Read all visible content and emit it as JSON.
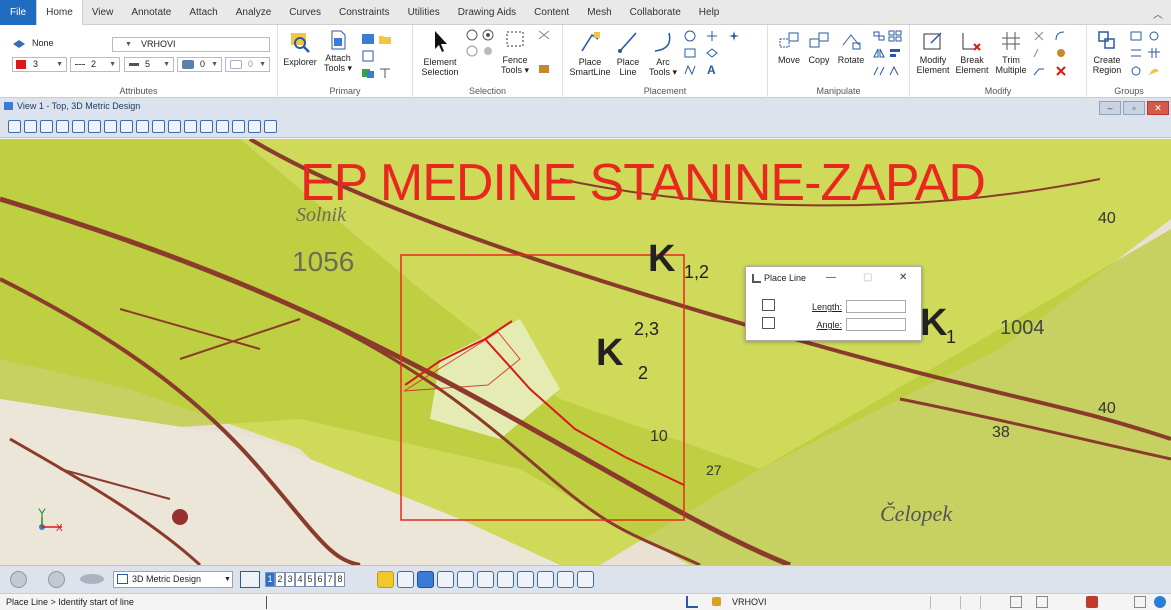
{
  "menu": {
    "tabs": [
      "File",
      "Home",
      "View",
      "Annotate",
      "Attach",
      "Analyze",
      "Curves",
      "Constraints",
      "Utilities",
      "Drawing Aids",
      "Content",
      "Mesh",
      "Collaborate",
      "Help"
    ],
    "active": "Home"
  },
  "ribbon": {
    "attributes": {
      "level": "None",
      "level2": "VRHOVI",
      "color_value": "3",
      "style_value": "2",
      "weight_value": "5",
      "transparency_value": "0",
      "priority_value": "0",
      "title": "Attributes"
    },
    "primary": {
      "explorer": "Explorer",
      "attach_tools_1": "Attach",
      "attach_tools_2": "Tools ▾",
      "title": "Primary"
    },
    "selection": {
      "element_selection_1": "Element",
      "element_selection_2": "Selection",
      "fence_tools_1": "Fence",
      "fence_tools_2": "Tools ▾",
      "title": "Selection"
    },
    "placement": {
      "place_smartline_1": "Place",
      "place_smartline_2": "SmartLine",
      "place_line_1": "Place",
      "place_line_2": "Line",
      "arc_tools_1": "Arc",
      "arc_tools_2": "Tools ▾",
      "title": "Placement"
    },
    "manipulate": {
      "move": "Move",
      "copy": "Copy",
      "rotate": "Rotate",
      "title": "Manipulate"
    },
    "modify": {
      "modify_element_1": "Modify",
      "modify_element_2": "Element",
      "break_element_1": "Break",
      "break_element_2": "Element",
      "trim_multiple_1": "Trim",
      "trim_multiple_2": "Multiple",
      "title": "Modify"
    },
    "groups": {
      "create_region_1": "Create",
      "create_region_2": "Region",
      "title": "Groups"
    }
  },
  "view": {
    "title": "View 1 - Top, 3D Metric Design"
  },
  "map": {
    "title": "EP MEDINE STANINE-ZAPAD",
    "labels": {
      "k12": "K",
      "k12_sub": "1,2",
      "k223": "K",
      "k223_sup": "2,3",
      "k223_sub": "2",
      "k1": "K",
      "k1_sub": "1",
      "n1056": "1056",
      "n1004": "1004",
      "n40a": "40",
      "n40b": "40",
      "n38": "38",
      "n10": "10",
      "n27": "27",
      "celopek": "Čelopek",
      "solnik": "Solnik",
      "axis_y": "Y",
      "axis_x": "X"
    }
  },
  "dialog": {
    "title": "Place Line",
    "length_label": "Length:",
    "angle_label": "Angle:",
    "length_value": "",
    "angle_value": ""
  },
  "bottom": {
    "model": "3D Metric Design",
    "views": [
      "1",
      "2",
      "3",
      "4",
      "5",
      "6",
      "7",
      "8"
    ]
  },
  "status": {
    "prompt": "Place Line > Identify start of line",
    "level": "VRHOVI"
  }
}
